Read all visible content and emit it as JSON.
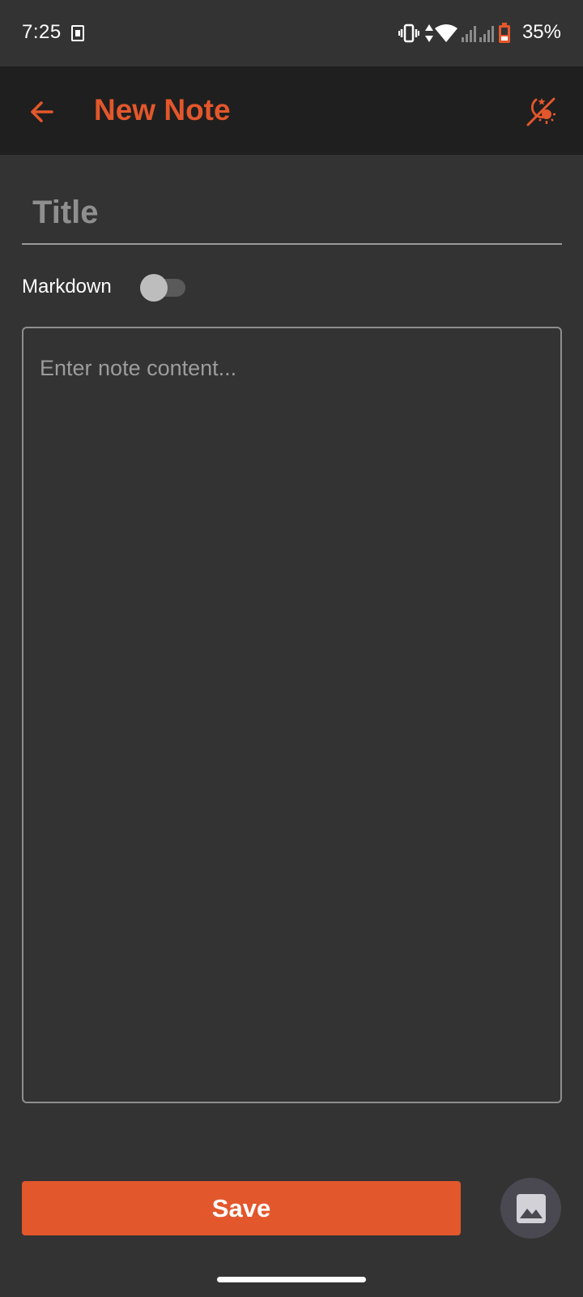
{
  "status_bar": {
    "time": "7:25",
    "battery_percent": "35%",
    "icons": [
      "sim-card-icon",
      "vibrate-icon",
      "data-transfer-icon",
      "wifi-icon",
      "signal-icon",
      "signal-icon",
      "battery-icon"
    ]
  },
  "app_bar": {
    "title": "New Note",
    "back_icon": "arrow-left-icon",
    "theme_icon": "theme-toggle-icon"
  },
  "form": {
    "title_placeholder": "Title",
    "markdown_label": "Markdown",
    "markdown_enabled": false,
    "content_placeholder": "Enter note content..."
  },
  "actions": {
    "save_label": "Save",
    "image_icon": "image-icon"
  },
  "colors": {
    "accent": "#e3572c",
    "background": "#333333",
    "app_bar": "#1f1f1f",
    "image_button": "#4a4851"
  }
}
